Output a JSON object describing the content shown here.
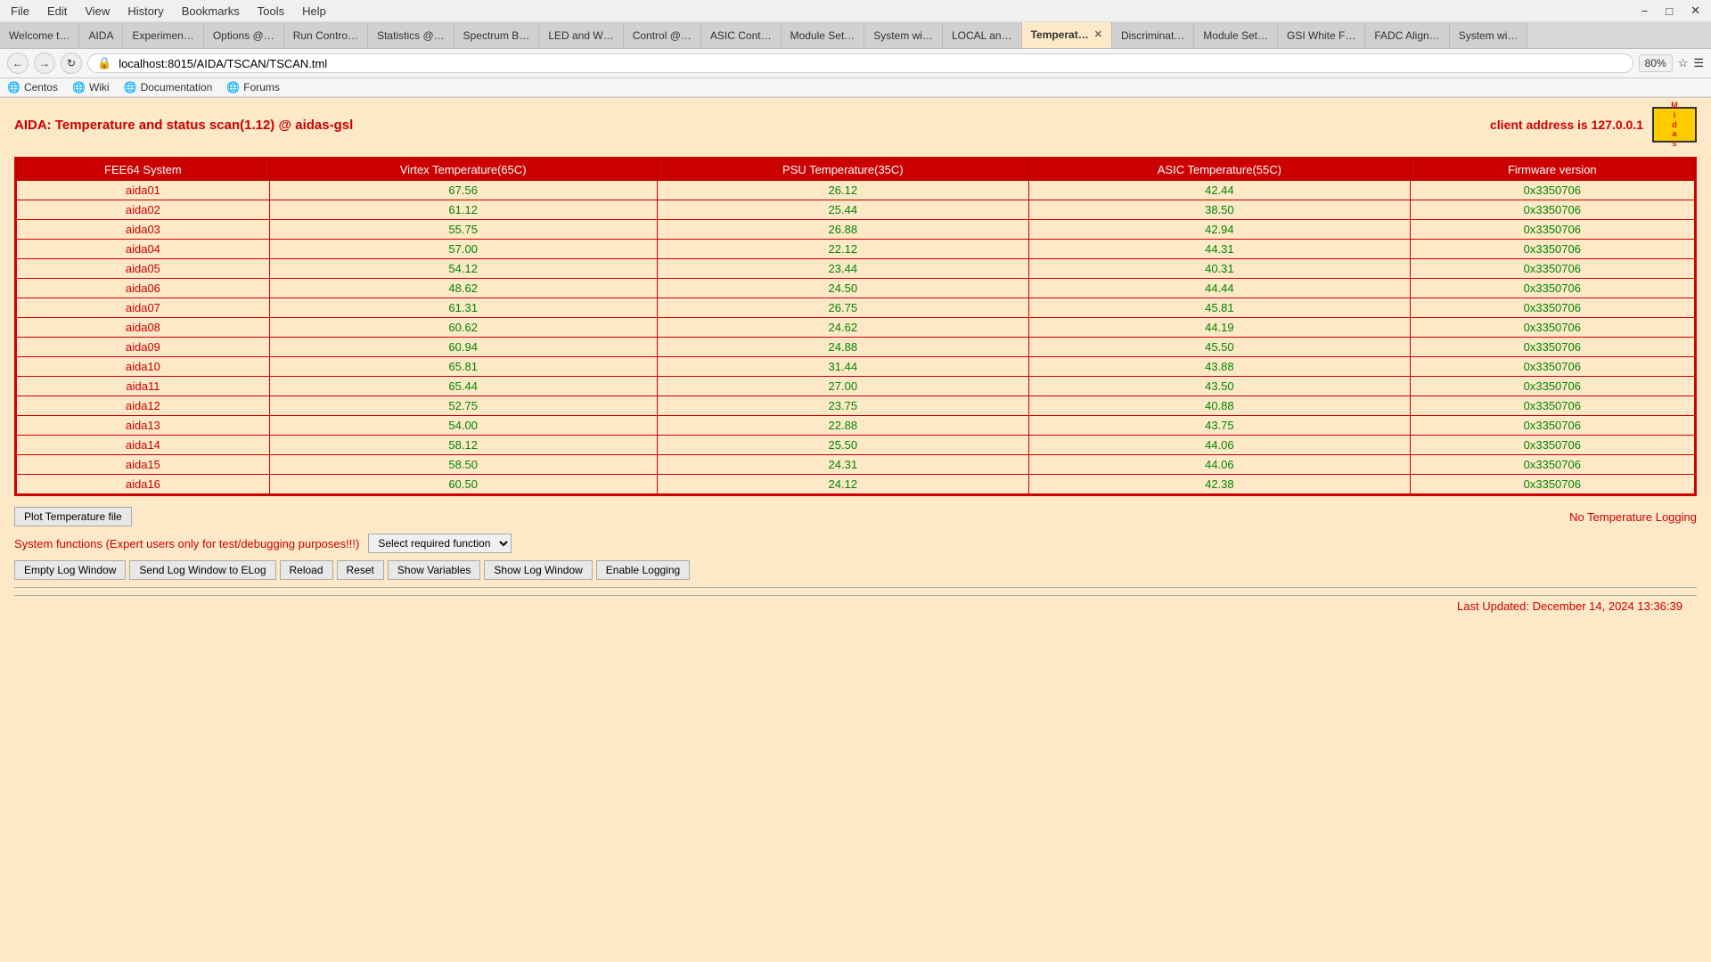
{
  "browser": {
    "menu": [
      "File",
      "Edit",
      "View",
      "History",
      "Bookmarks",
      "Tools",
      "Help"
    ],
    "address": "localhost:8015/AIDA/TSCAN/TSCAN.tml",
    "zoom": "80%",
    "bookmarks": [
      "Centos",
      "Wiki",
      "Documentation",
      "Forums"
    ]
  },
  "tabs": [
    {
      "label": "Welcome t…",
      "active": false
    },
    {
      "label": "AIDA",
      "active": false
    },
    {
      "label": "Experimen…",
      "active": false
    },
    {
      "label": "Options @…",
      "active": false
    },
    {
      "label": "Run Contro…",
      "active": false
    },
    {
      "label": "Statistics @…",
      "active": false
    },
    {
      "label": "Spectrum B…",
      "active": false
    },
    {
      "label": "LED and W…",
      "active": false
    },
    {
      "label": "Control @…",
      "active": false
    },
    {
      "label": "ASIC Cont…",
      "active": false
    },
    {
      "label": "Module Set…",
      "active": false
    },
    {
      "label": "System wi…",
      "active": false
    },
    {
      "label": "LOCAL an…",
      "active": false
    },
    {
      "label": "Temperat…",
      "active": true,
      "closeable": true
    },
    {
      "label": "Discriminat…",
      "active": false
    },
    {
      "label": "Module Set…",
      "active": false
    },
    {
      "label": "GSI White F…",
      "active": false
    },
    {
      "label": "FADC Align…",
      "active": false
    },
    {
      "label": "System wi…",
      "active": false
    }
  ],
  "page": {
    "title": "AIDA: Temperature and status scan(1.12) @ aidas-gsl",
    "client_address": "client address is 127.0.0.1"
  },
  "table": {
    "headers": [
      "FEE64 System",
      "Virtex Temperature(65C)",
      "PSU Temperature(35C)",
      "ASIC Temperature(55C)",
      "Firmware version"
    ],
    "rows": [
      [
        "aida01",
        "67.56",
        "26.12",
        "42.44",
        "0x3350706"
      ],
      [
        "aida02",
        "61.12",
        "25.44",
        "38.50",
        "0x3350706"
      ],
      [
        "aida03",
        "55.75",
        "26.88",
        "42.94",
        "0x3350706"
      ],
      [
        "aida04",
        "57.00",
        "22.12",
        "44.31",
        "0x3350706"
      ],
      [
        "aida05",
        "54.12",
        "23.44",
        "40.31",
        "0x3350706"
      ],
      [
        "aida06",
        "48.62",
        "24.50",
        "44.44",
        "0x3350706"
      ],
      [
        "aida07",
        "61.31",
        "26.75",
        "45.81",
        "0x3350706"
      ],
      [
        "aida08",
        "60.62",
        "24.62",
        "44.19",
        "0x3350706"
      ],
      [
        "aida09",
        "60.94",
        "24.88",
        "45.50",
        "0x3350706"
      ],
      [
        "aida10",
        "65.81",
        "31.44",
        "43.88",
        "0x3350706"
      ],
      [
        "aida11",
        "65.44",
        "27.00",
        "43.50",
        "0x3350706"
      ],
      [
        "aida12",
        "52.75",
        "23.75",
        "40.88",
        "0x3350706"
      ],
      [
        "aida13",
        "54.00",
        "22.88",
        "43.75",
        "0x3350706"
      ],
      [
        "aida14",
        "58.12",
        "25.50",
        "44.06",
        "0x3350706"
      ],
      [
        "aida15",
        "58.50",
        "24.31",
        "44.06",
        "0x3350706"
      ],
      [
        "aida16",
        "60.50",
        "24.12",
        "42.38",
        "0x3350706"
      ]
    ]
  },
  "buttons": {
    "plot_temperature": "Plot Temperature file",
    "no_logging": "No Temperature Logging",
    "system_functions_label": "System functions (Expert users only for test/debugging purposes!!!)",
    "select_required": "Select required function",
    "empty_log": "Empty Log Window",
    "send_log": "Send Log Window to ELog",
    "reload": "Reload",
    "reset": "Reset",
    "show_variables": "Show Variables",
    "show_log_window": "Show Log Window",
    "enable_logging": "Enable Logging"
  },
  "footer": {
    "last_updated": "Last Updated: December 14, 2024 13:36:39"
  }
}
